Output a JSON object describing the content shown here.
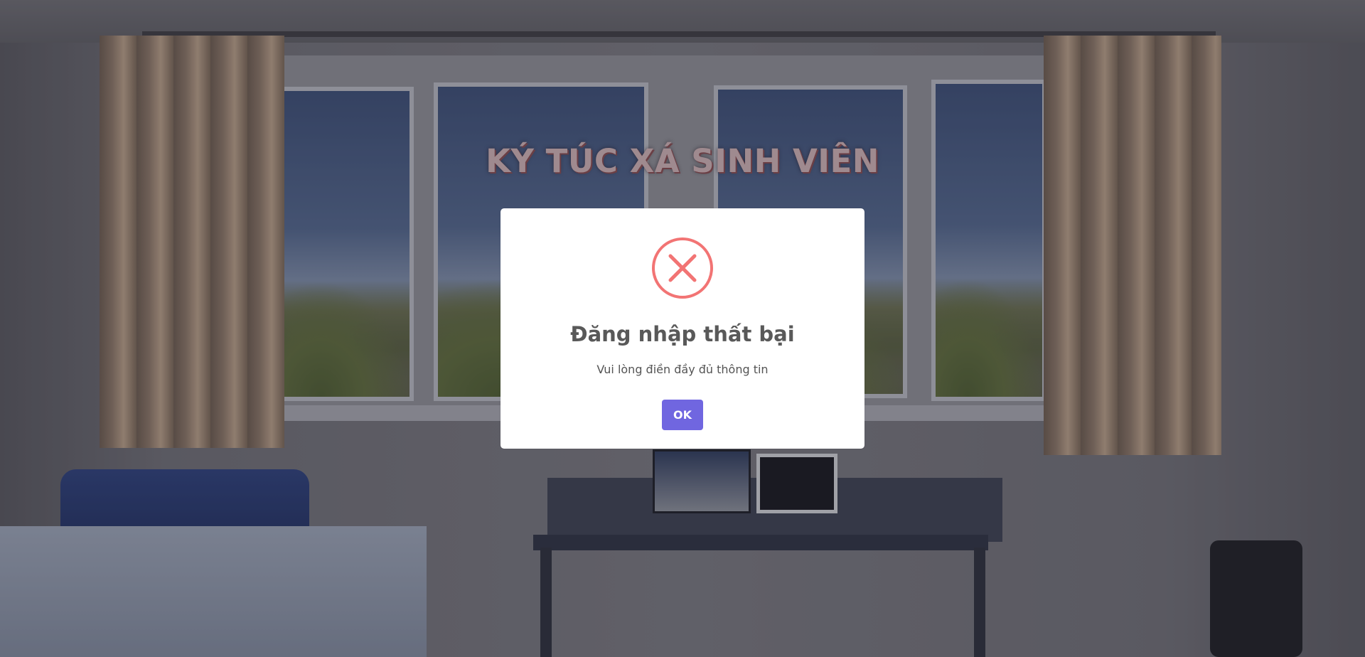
{
  "page": {
    "title": "KÝ TÚC XÁ SINH VIÊN"
  },
  "dialog": {
    "icon": "error-x-icon",
    "title": "Đăng nhập thất bại",
    "message": "Vui lòng điền đầy đủ thông tin",
    "confirm_label": "OK"
  },
  "colors": {
    "accent": "#7066e0",
    "error": "#f27474",
    "heading": "#595959"
  }
}
